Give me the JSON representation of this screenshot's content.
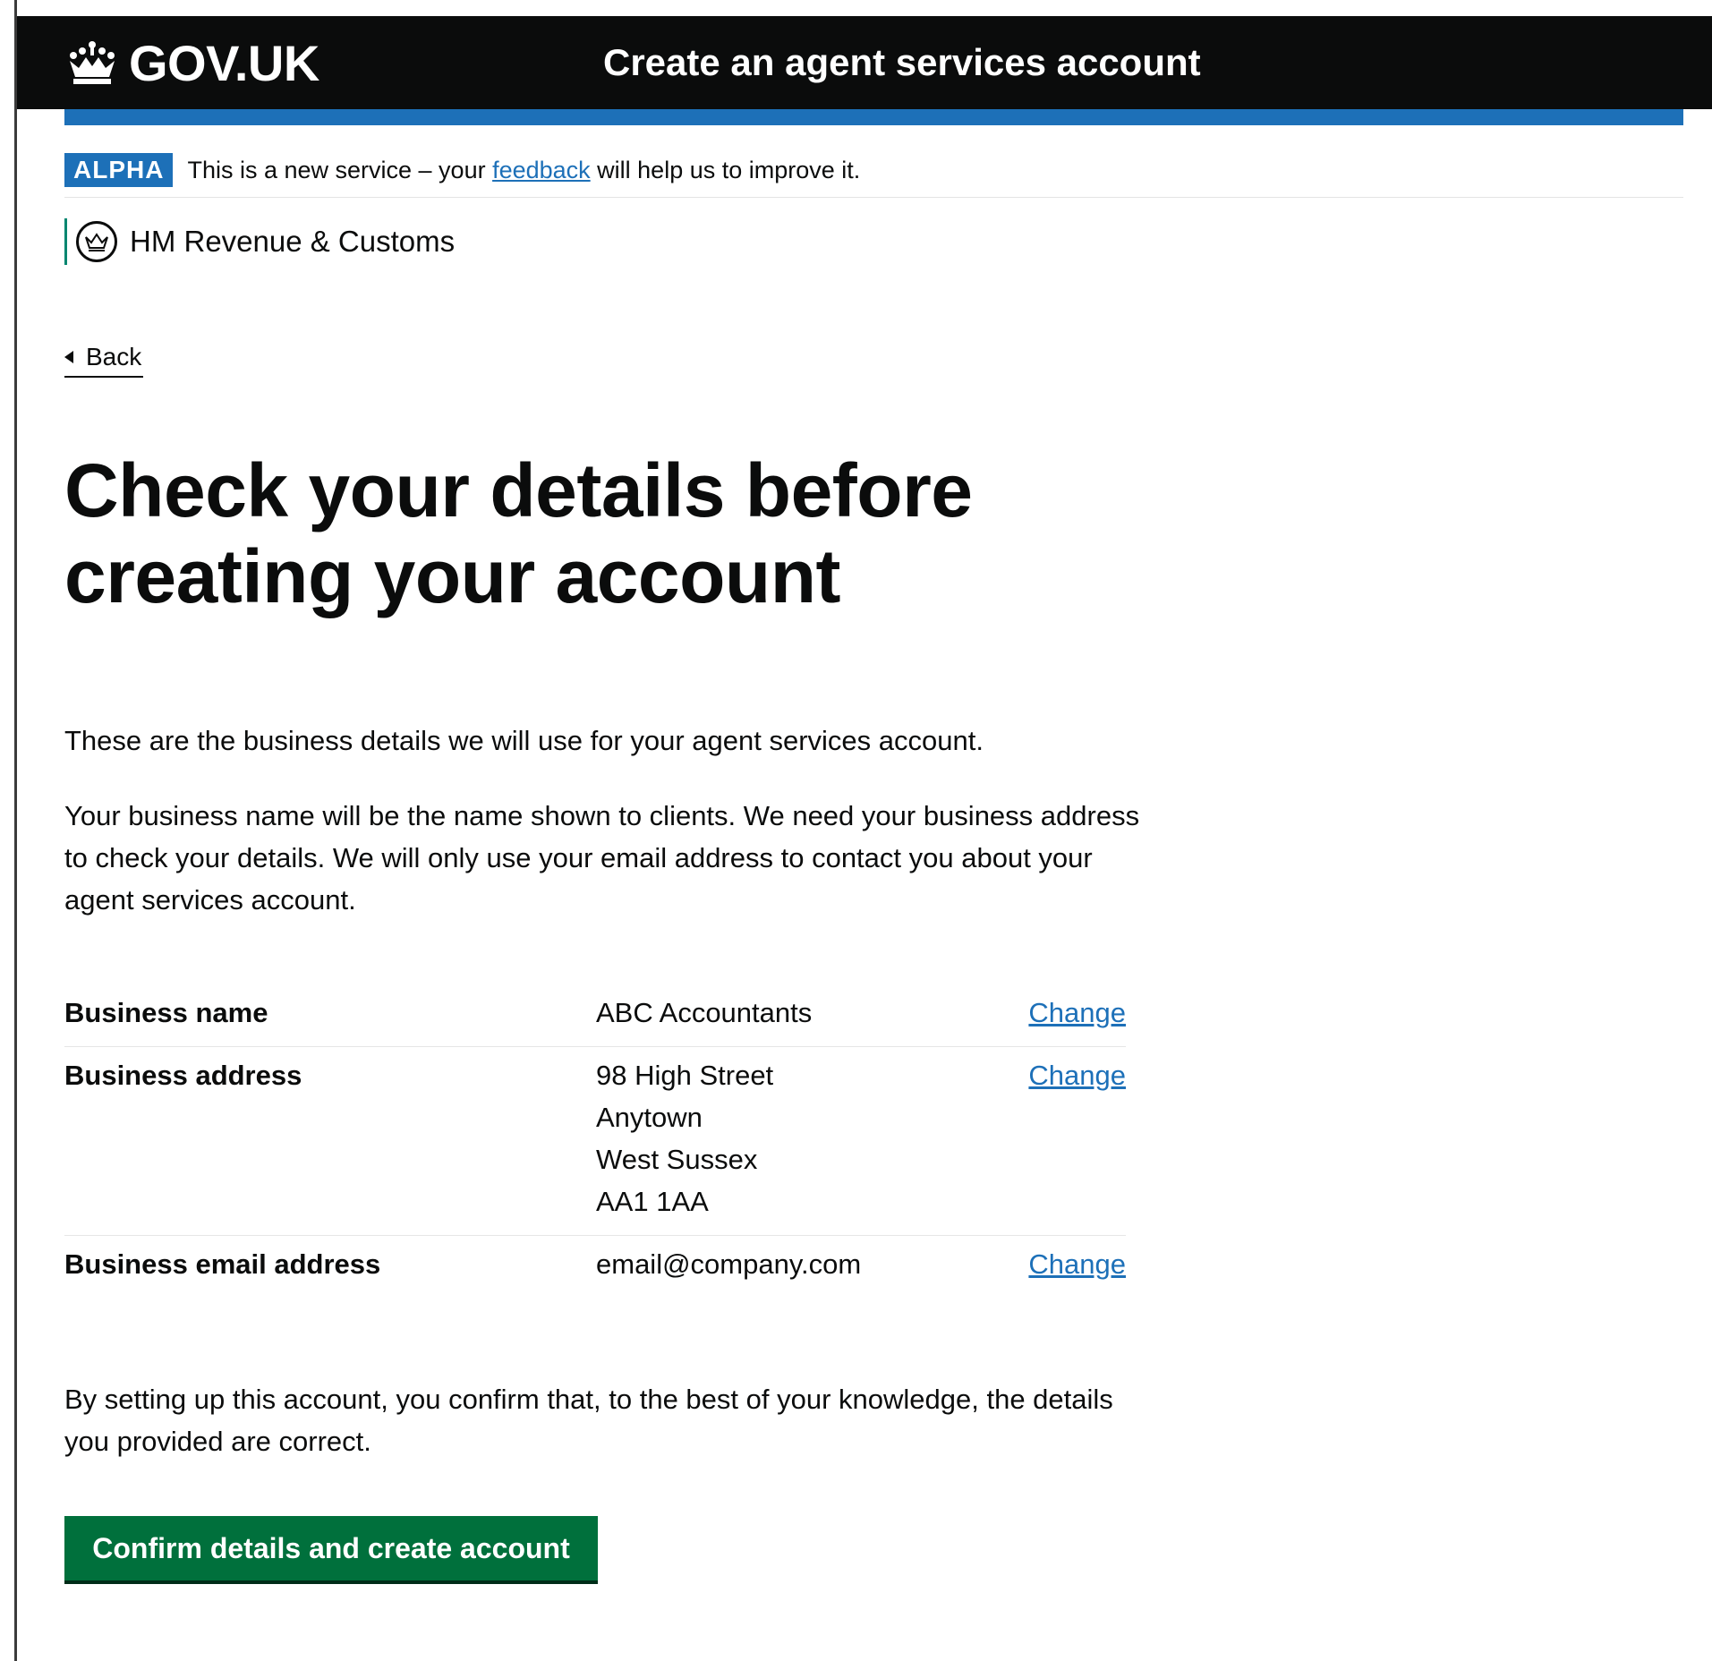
{
  "header": {
    "logo_text": "GOV.UK",
    "service_name": "Create an agent services account"
  },
  "phase_banner": {
    "tag": "ALPHA",
    "text_before": "This is a new service – your ",
    "link_text": "feedback",
    "text_after": " will help us to improve it."
  },
  "organisation": {
    "name": "HM Revenue & Customs"
  },
  "back_link": {
    "label": "Back"
  },
  "main": {
    "heading": "Check your details before creating your account",
    "intro_1": "These are the business details we will use for your agent services account.",
    "intro_2": "Your business name will be the name shown to clients. We need your business address to check your details. We will only use your email address to contact you about your agent services account.",
    "summary": [
      {
        "key": "Business name",
        "value_lines": [
          "ABC Accountants"
        ],
        "action": "Change"
      },
      {
        "key": "Business address",
        "value_lines": [
          "98 High Street",
          "Anytown",
          "West Sussex",
          "AA1 1AA"
        ],
        "action": "Change"
      },
      {
        "key": "Business email address",
        "value_lines": [
          "email@company.com"
        ],
        "action": "Change"
      }
    ],
    "declaration": "By setting up this account, you confirm that, to the best of your knowledge, the details you provided are correct.",
    "submit_label": "Confirm details and create account"
  },
  "colors": {
    "header_bg": "#0b0c0c",
    "brand_blue": "#1d70b8",
    "button_green": "#00703c",
    "org_accent": "#008670"
  }
}
